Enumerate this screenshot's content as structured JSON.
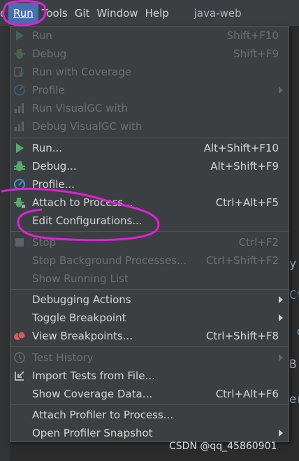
{
  "menubar": {
    "partial_item": "d",
    "items": [
      {
        "label": "Run"
      },
      {
        "label": "Tools"
      },
      {
        "label": "Git"
      },
      {
        "label": "Window"
      },
      {
        "label": "Help"
      }
    ],
    "project_title": "java-web"
  },
  "side_fragments": [
    "y",
    "Ct",
    "c",
    "B",
    "er"
  ],
  "menu": {
    "items": [
      {
        "label": "Run",
        "shortcut": "Shift+F10",
        "icon": "run-icon",
        "enabled": false
      },
      {
        "label": "Debug",
        "shortcut": "Shift+F9",
        "icon": "debug-icon",
        "enabled": false
      },
      {
        "label": "Run with Coverage",
        "shortcut": "",
        "icon": "coverage-icon",
        "enabled": false
      },
      {
        "label": "Profile",
        "shortcut": "",
        "icon": "profile-icon",
        "enabled": false,
        "submenu": true
      },
      {
        "label": "Run VisualGC with",
        "shortcut": "",
        "icon": "visualgc-icon",
        "enabled": false
      },
      {
        "label": "Debug VisualGC with",
        "shortcut": "",
        "icon": "visualgc-debug-icon",
        "enabled": false
      },
      {
        "label": "Run...",
        "shortcut": "Alt+Shift+F10",
        "icon": "run-icon",
        "enabled": true
      },
      {
        "label": "Debug...",
        "shortcut": "Alt+Shift+F9",
        "icon": "debug-icon",
        "enabled": true
      },
      {
        "label": "Profile...",
        "shortcut": "",
        "icon": "profile-icon",
        "enabled": true
      },
      {
        "label": "Attach to Process...",
        "shortcut": "Ctrl+Alt+F5",
        "icon": "attach-process-icon",
        "enabled": true
      },
      {
        "label": "Edit Configurations...",
        "shortcut": "",
        "icon": "",
        "enabled": true
      },
      {
        "label": "Stop",
        "shortcut": "Ctrl+F2",
        "icon": "stop-icon",
        "enabled": false
      },
      {
        "label": "Stop Background Processes...",
        "shortcut": "Ctrl+Shift+F2",
        "icon": "",
        "enabled": false
      },
      {
        "label": "Show Running List",
        "shortcut": "",
        "icon": "",
        "enabled": false
      },
      {
        "label": "Debugging Actions",
        "shortcut": "",
        "icon": "",
        "enabled": true,
        "submenu": true
      },
      {
        "label": "Toggle Breakpoint",
        "shortcut": "",
        "icon": "",
        "enabled": true,
        "submenu": true
      },
      {
        "label": "View Breakpoints...",
        "shortcut": "Ctrl+Shift+F8",
        "icon": "breakpoints-icon",
        "enabled": true
      },
      {
        "label": "Test History",
        "shortcut": "",
        "icon": "history-icon",
        "enabled": false,
        "submenu": true
      },
      {
        "label": "Import Tests from File...",
        "shortcut": "",
        "icon": "import-tests-icon",
        "enabled": true
      },
      {
        "label": "Show Coverage Data...",
        "shortcut": "Ctrl+Alt+F6",
        "icon": "",
        "enabled": true
      },
      {
        "label": "Attach Profiler to Process...",
        "shortcut": "",
        "icon": "",
        "enabled": true
      },
      {
        "label": "Open Profiler Snapshot",
        "shortcut": "",
        "icon": "",
        "enabled": true,
        "submenu": true
      }
    ]
  },
  "watermark": "CSDN @qq_45860901",
  "colors": {
    "menu_bg": "#3c3f41",
    "editor_bg": "#2b2b2b",
    "selected_menu": "#4b6eaf",
    "annotation": "#e020d8",
    "run_green": "#59a869",
    "debug_green": "#59a869",
    "profile_blue": "#3592c4",
    "breakpoint_red": "#db5860"
  }
}
